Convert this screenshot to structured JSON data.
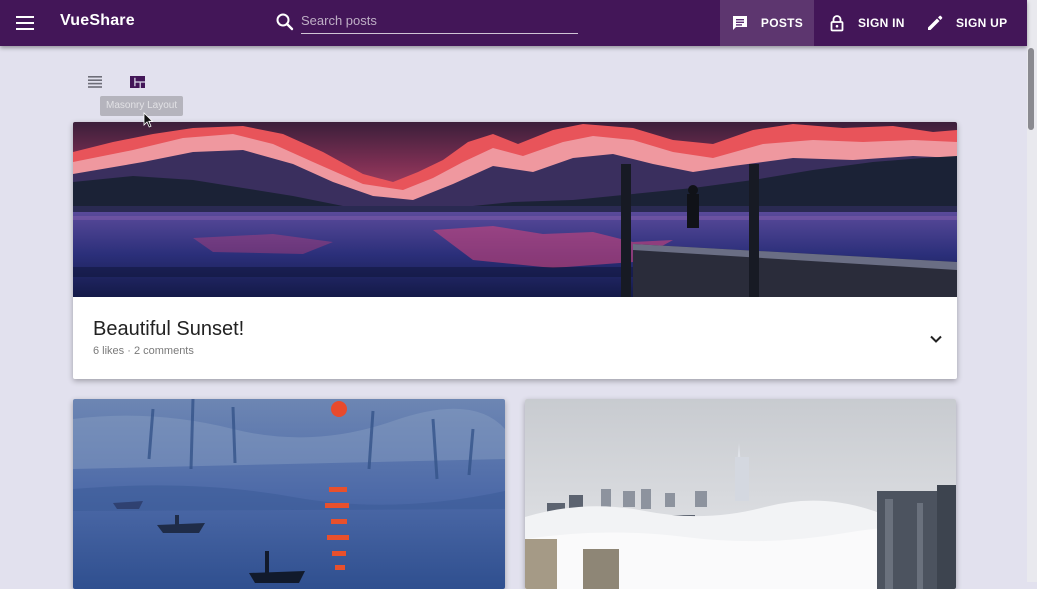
{
  "app": {
    "title": "VueShare"
  },
  "search": {
    "placeholder": "Search posts",
    "value": ""
  },
  "nav": [
    {
      "label": "POSTS",
      "icon": "chat-icon",
      "active": true
    },
    {
      "label": "SIGN IN",
      "icon": "lock-icon"
    },
    {
      "label": "SIGN UP",
      "icon": "pencil-icon"
    }
  ],
  "layout_toggle": {
    "options": [
      {
        "icon": "list-layout-icon"
      },
      {
        "icon": "masonry-layout-icon",
        "active": true
      }
    ],
    "tooltip": "Masonry Layout"
  },
  "posts": [
    {
      "title": "Beautiful Sunset!",
      "meta": "6 likes · 2 comments",
      "image": "mountain lake sunset with pier"
    },
    {
      "image": "impressionist harbour painting at sunrise"
    },
    {
      "image": "city skyscrapers above fog"
    }
  ],
  "colors": {
    "app_bar": "#431658",
    "page_background": "#e2e1ee",
    "active_toggle": "#431658"
  }
}
